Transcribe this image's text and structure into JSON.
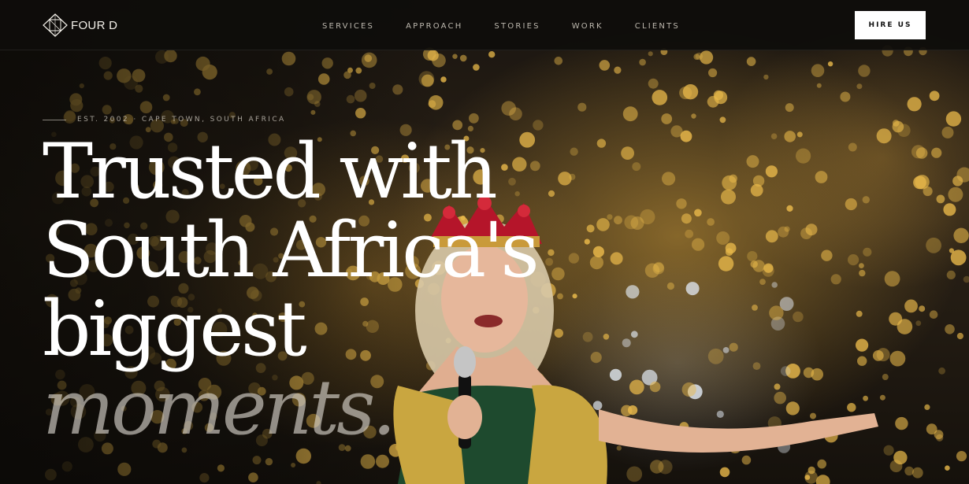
{
  "brand": {
    "name": "FOUR D"
  },
  "nav": {
    "items": [
      "SERVICES",
      "APPROACH",
      "STORIES",
      "WORK",
      "CLIENTS"
    ],
    "cta_label": "HIRE US"
  },
  "hero": {
    "eyebrow": "EST. 2002 · CAPE TOWN, SOUTH AFRICA",
    "headline_lines": [
      "Trusted with",
      "South Africa's",
      "biggest"
    ],
    "headline_accent": "moments."
  },
  "colors": {
    "background": "#0b0a08",
    "header_bg": "#0e0d0b",
    "text_primary": "#ffffff",
    "text_muted": "#bdb8ae",
    "cta_bg": "#ffffff",
    "cta_text": "#111111",
    "bokeh_gold": "#e8b84a"
  }
}
